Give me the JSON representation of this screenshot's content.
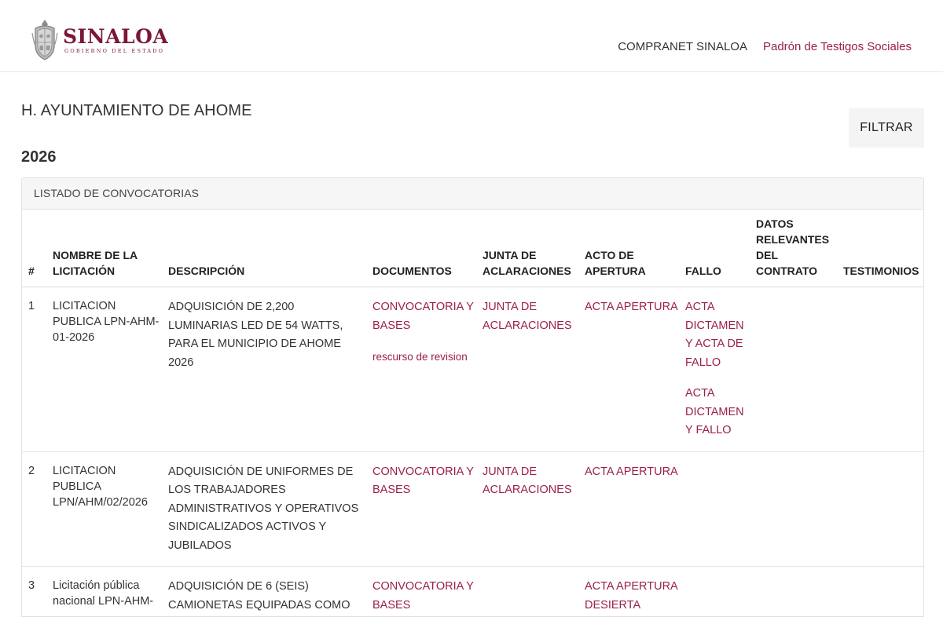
{
  "header": {
    "logo_name": "SINALOA",
    "logo_subtitle": "GOBIERNO DEL ESTADO",
    "nav": [
      {
        "label": "COMPRANET SINALOA"
      },
      {
        "label": "Padrón de Testigos Sociales"
      }
    ]
  },
  "page": {
    "title": "H. AYUNTAMIENTO DE AHOME",
    "year": "2026",
    "filter_label": "FILTRAR"
  },
  "panel": {
    "title": "LISTADO DE CONVOCATORIAS",
    "columns": {
      "num": "#",
      "name": "NOMBRE DE LA LICITACIÓN",
      "description": "DESCRIPCIÓN",
      "documents": "DOCUMENTOS",
      "clarifications": "JUNTA DE ACLARACIONES",
      "opening": "ACTO DE APERTURA",
      "ruling": "FALLO",
      "contract": "DATOS RELEVANTES DEL CONTRATO",
      "testimonies": "TESTIMONIOS"
    },
    "rows": [
      {
        "num": "1",
        "name": "LICITACION PUBLICA LPN-AHM-01-2026",
        "description": "ADQUISICIÓN DE 2,200 LUMINARIAS LED DE 54 WATTS, PARA EL MUNICIPIO DE AHOME 2026",
        "documents": [
          "CONVOCATORIA Y BASES",
          "rescurso de revision"
        ],
        "clarifications": [
          "JUNTA DE ACLARACIONES"
        ],
        "opening": [
          "ACTA APERTURA"
        ],
        "ruling": [
          "ACTA DICTAMEN Y ACTA DE FALLO",
          "ACTA DICTAMEN Y FALLO"
        ]
      },
      {
        "num": "2",
        "name": "LICITACION PUBLICA LPN/AHM/02/2026",
        "description": "ADQUISICIÓN DE UNIFORMES DE LOS TRABAJADORES ADMINISTRATIVOS Y OPERATIVOS SINDICALIZADOS ACTIVOS Y JUBILADOS",
        "documents": [
          "CONVOCATORIA Y BASES"
        ],
        "clarifications": [
          "JUNTA DE ACLARACIONES"
        ],
        "opening": [
          "ACTA APERTURA"
        ]
      },
      {
        "num": "3",
        "name": "Licitación pública nacional LPN-AHM-",
        "description": "ADQUISICIÓN DE 6 (SEIS) CAMIONETAS EQUIPADAS COMO",
        "documents": [
          "CONVOCATORIA Y BASES"
        ],
        "opening": [
          "ACTA APERTURA DESIERTA"
        ]
      }
    ]
  },
  "colors": {
    "brand": "#7a1735",
    "link": "#9b1f4b",
    "text": "#333333"
  }
}
